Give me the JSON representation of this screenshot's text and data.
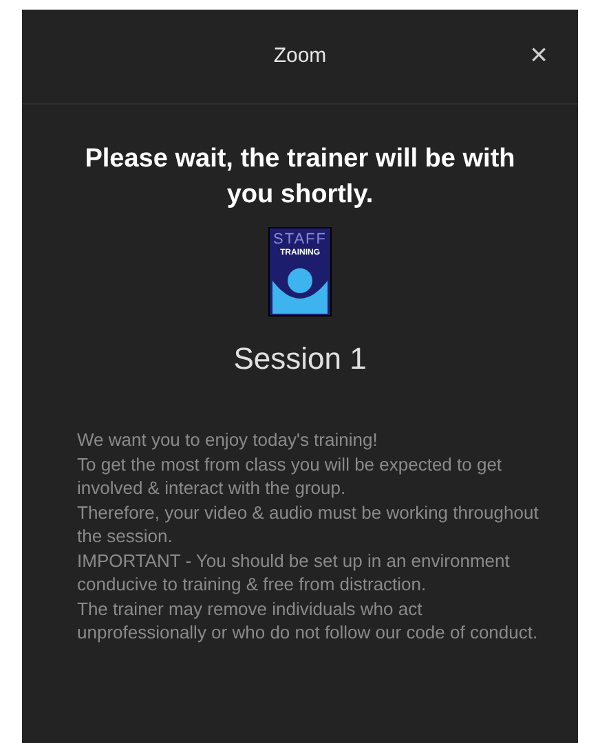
{
  "header": {
    "title": "Zoom",
    "close": "×"
  },
  "heading": "Please wait, the trainer will be with you shortly.",
  "logo": {
    "top": "STAFF",
    "bottom": "TRAINING"
  },
  "session": "Session 1",
  "paragraphs": [
    "We want you to enjoy today's training!",
    "To get the most from class you will be expected to get involved & interact with the group.",
    "Therefore, your video & audio must be working throughout the session.",
    "IMPORTANT - You should be set up in an environment conducive to training & free from distraction.",
    "The trainer may remove individuals who act unprofessionally or who do not follow our code of conduct."
  ]
}
